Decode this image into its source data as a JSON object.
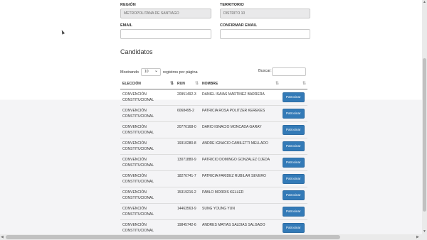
{
  "form": {
    "region_label": "REGIÓN",
    "region_value": "METROPOLITANA DE SANTIAGO",
    "territory_label": "TERRITORIO",
    "territory_value": "DISTRITO 10",
    "email_label": "EMAIL",
    "email_value": "",
    "confirm_email_label": "CONFIRMAR EMAIL",
    "confirm_email_value": ""
  },
  "candidates": {
    "title": "Candidatos",
    "show_prefix": "Mostrando",
    "page_size": "10",
    "show_suffix": "registros por página",
    "search_label": "Buscar:",
    "search_value": "",
    "columns": [
      "ELECCIÓN",
      "RUN",
      "NOMBRE",
      ""
    ],
    "sponsor_label": "Patrocinar",
    "rows": [
      {
        "election": "CONVENCIÓN CONSTITUCIONAL",
        "run": "20951492-3",
        "name": "DANIEL ISAIAS MARTINEZ BARRERA"
      },
      {
        "election": "CONVENCIÓN CONSTITUCIONAL",
        "run": "6068495-2",
        "name": "PATRICIA ROSA POLITZER KEREKES"
      },
      {
        "election": "CONVENCIÓN CONSTITUCIONAL",
        "run": "20776168-0",
        "name": "DARIO IGNACIO MONCADA GARAY"
      },
      {
        "election": "CONVENCIÓN CONSTITUCIONAL",
        "run": "19310280-8",
        "name": "ANDRE IGNACIO CAMILETTI MELLADO"
      },
      {
        "election": "CONVENCIÓN CONSTITUCIONAL",
        "run": "13071880-9",
        "name": "PATRICIO DOMINGO GONZALEZ OJEDA"
      },
      {
        "election": "CONVENCIÓN CONSTITUCIONAL",
        "run": "18276741-7",
        "name": "PATRICIA FARIDEZ RUBILAR SEVERO"
      },
      {
        "election": "CONVENCIÓN CONSTITUCIONAL",
        "run": "15319216-2",
        "name": "PABLO MORRIS KELLER"
      },
      {
        "election": "CONVENCIÓN CONSTITUCIONAL",
        "run": "14463563-9",
        "name": "SUNG YOUNG YUN"
      },
      {
        "election": "CONVENCIÓN CONSTITUCIONAL",
        "run": "19845742-6",
        "name": "ANDRES MATIAS SALDIAS SALGADO"
      }
    ]
  },
  "colors": {
    "button": "#337ab7"
  }
}
